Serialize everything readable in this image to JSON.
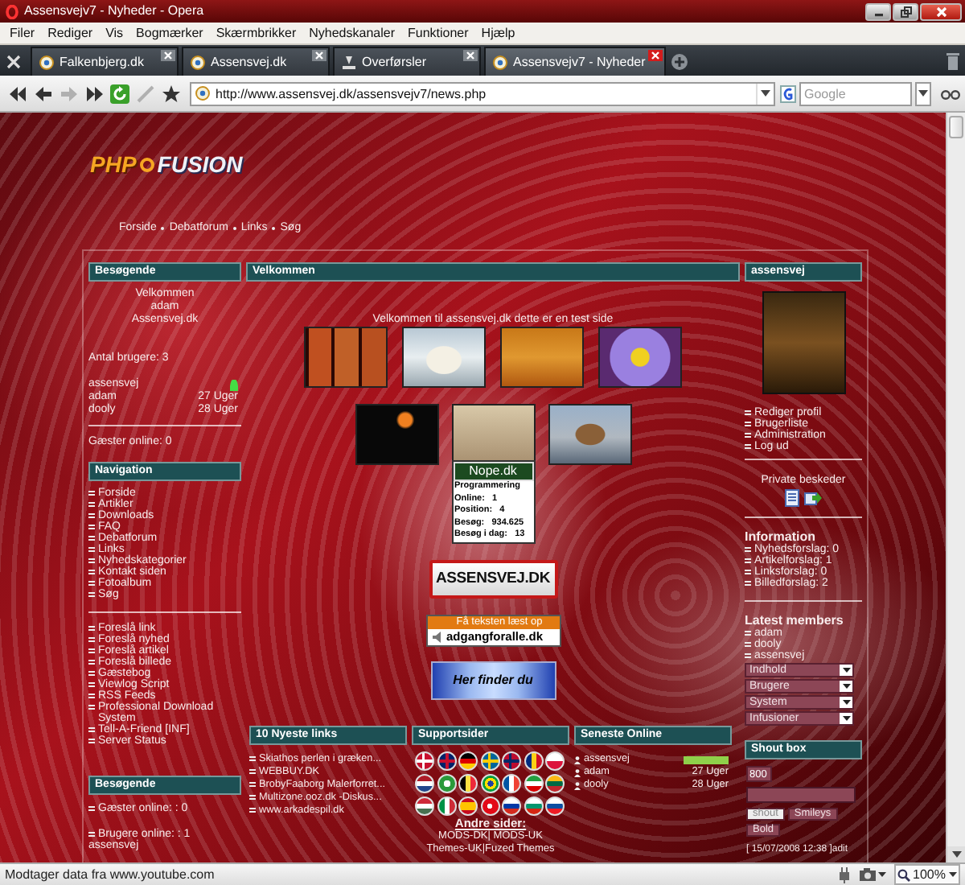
{
  "window": {
    "title": "Assensvejv7 - Nyheder - Opera"
  },
  "menu": [
    "Filer",
    "Rediger",
    "Vis",
    "Bogmærker",
    "Skærmbrikker",
    "Nyhedskanaler",
    "Funktioner",
    "Hjælp"
  ],
  "tabs": [
    {
      "label": "Falkenbjerg.dk",
      "kind": "page",
      "selected": false
    },
    {
      "label": "Assensvej.dk",
      "kind": "page",
      "selected": false
    },
    {
      "label": "Overførsler",
      "kind": "transfers",
      "selected": false
    },
    {
      "label": "Assensvejv7 - Nyheder",
      "kind": "page",
      "selected": true
    }
  ],
  "nav_buttons": [
    {
      "kind": "rewind",
      "disabled": false
    },
    {
      "kind": "back",
      "disabled": false
    },
    {
      "kind": "forward",
      "disabled": true
    },
    {
      "kind": "fast_forward",
      "disabled": false
    },
    {
      "kind": "reload",
      "disabled": false
    },
    {
      "kind": "edit",
      "disabled": true
    },
    {
      "kind": "bookmark",
      "disabled": false
    }
  ],
  "address": {
    "url": "http://www.assensvej.dk/assensvejv7/news.php",
    "search_placeholder": "Google"
  },
  "page": {
    "logo": {
      "left": "PHP",
      "right": "FUSION"
    },
    "breadcrumb": [
      "Forside",
      "Debatforum",
      "Links",
      "Søg"
    ],
    "visitors": {
      "title": "Besøgende",
      "welcome": [
        "Velkommen",
        "adam",
        "Assensvej.dk"
      ],
      "count": "Antal brugere: 3",
      "users": [
        {
          "name": "assensvej",
          "online": true
        },
        {
          "name": "adam",
          "time": "27 Uger",
          "online": false
        },
        {
          "name": "dooly",
          "time": "28 Uger",
          "online": false
        }
      ],
      "guests": "Gæster online: 0"
    },
    "navigation": {
      "title": "Navigation",
      "groups": [
        [
          "Forside",
          "Artikler",
          "Downloads",
          "FAQ",
          "Debatforum",
          "Links",
          "Nyhedskategorier",
          "Kontakt siden",
          "Fotoalbum",
          "Søg"
        ],
        [
          "Foreslå link",
          "Foreslå nyhed",
          "Foreslå artikel",
          "Foreslå billede",
          "Gæstebog",
          "Viewlog Script",
          "RSS Feeds",
          "Professional Download System",
          "Tell-A-Friend [INF]",
          "Server Status"
        ]
      ]
    },
    "visitors_online": {
      "title": "Besøgende",
      "guests": "Gæster online: : 0",
      "users_label": "Brugere online: : 1",
      "users": [
        "assensvej"
      ]
    },
    "welcome": {
      "title": "Velkommen",
      "text": "Velkommen til assensvej.dk dette er en test side"
    },
    "counter": {
      "title": "Nope.dk",
      "lines": [
        "Programmering",
        "Online:   1",
        "Position:   4",
        "Besøg:   934.625",
        "Besøg i dag:   13"
      ]
    },
    "banners": [
      {
        "kind": "logo",
        "text": "ASSENSVEJ.DK"
      },
      {
        "kind": "speech",
        "caption": "Få teksten læst op",
        "text": "adgangforalle.dk"
      },
      {
        "kind": "finder",
        "text": "Her finder du"
      }
    ],
    "links": {
      "title": "10 Nyeste links",
      "items": [
        "Skiathos perlen i græken...",
        "WEBBUY.DK",
        "BrobyFaaborg Malerforret...",
        "Multizone.ooz.dk -Diskus...",
        "www.arkadespil.dk"
      ]
    },
    "support": {
      "title": "Supportsider",
      "more_title": "Andre sider:",
      "more_lines": [
        "MODS-DK| MODS-UK",
        "Themes-UK|Fuzed Themes"
      ]
    },
    "online": {
      "title": "Seneste Online",
      "users": [
        {
          "name": "assensvej",
          "online": true
        },
        {
          "name": "adam",
          "time": "27 Uger",
          "online": false
        },
        {
          "name": "dooly",
          "time": "28 Uger",
          "online": false
        }
      ]
    },
    "user_panel": {
      "title": "assensvej",
      "links": [
        "Rediger profil",
        "Brugerliste",
        "Administration",
        "Log ud"
      ],
      "messages": "Private beskeder"
    },
    "information": {
      "title": "Information",
      "items": [
        "Nyhedsforslag: 0",
        "Artikelforslag: 1",
        "Linksforslag: 0",
        "Billedforslag: 2"
      ]
    },
    "members": {
      "title": "Latest members",
      "items": [
        "adam",
        "dooly",
        "assensvej"
      ]
    },
    "admin_menus": [
      "Indhold",
      "Brugere",
      "System",
      "Infusioner"
    ],
    "shoutbox": {
      "title": "Shout box",
      "name_value": "800",
      "buttons": [
        "shout",
        "Smileys",
        "Bold"
      ],
      "entry": "[ 15/07/2008 12:38 ]adit"
    }
  },
  "status_bar": {
    "text": "Modtager data fra www.youtube.com",
    "zoom": "100%"
  }
}
